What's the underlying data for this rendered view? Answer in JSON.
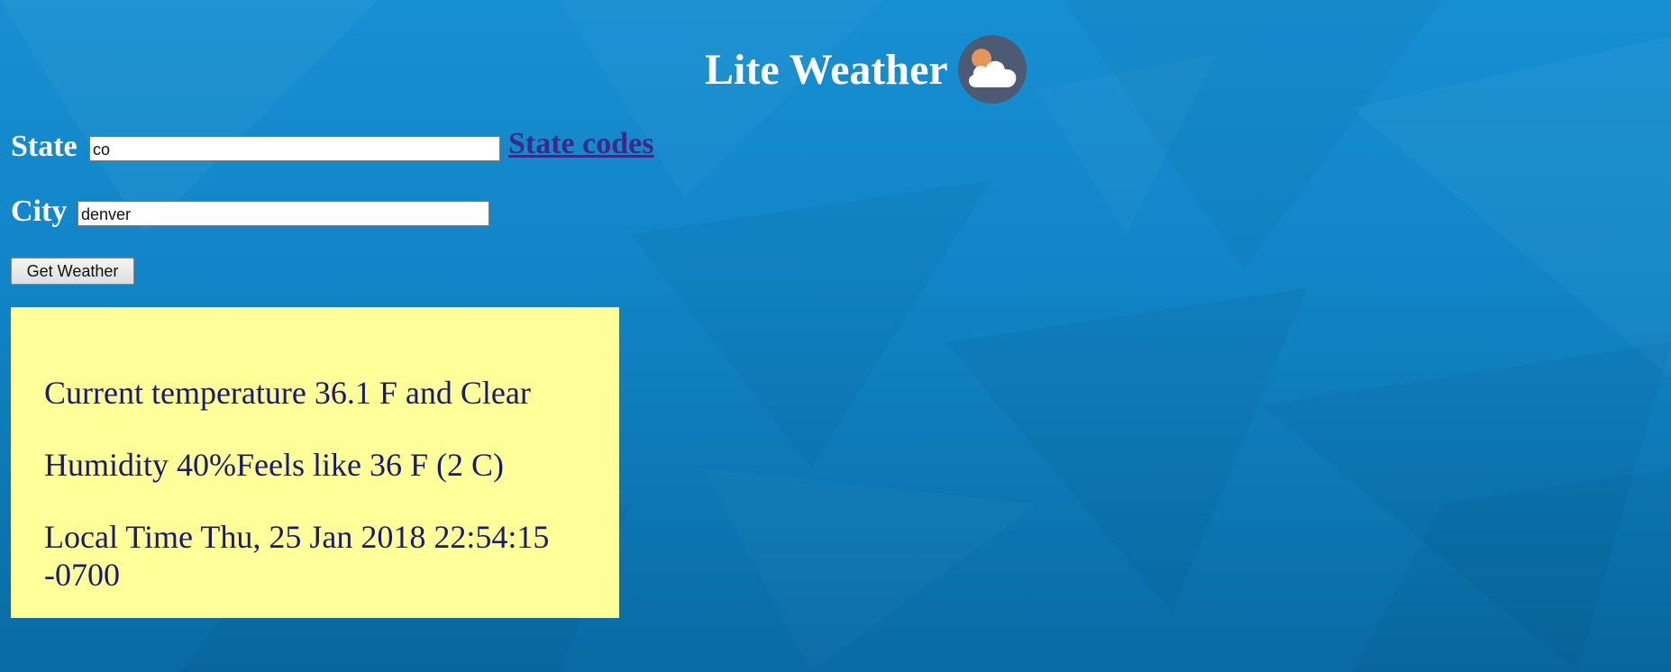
{
  "app": {
    "title": "Lite Weather",
    "logo_icon": "sun-cloud-icon"
  },
  "form": {
    "state_label": "State",
    "state_value": "co",
    "state_codes_link": "State codes",
    "city_label": "City",
    "city_value": "denver",
    "submit_label": "Get Weather"
  },
  "result": {
    "temperature_line": "Current temperature 36.1 F and Clear",
    "humidity_line": "Humidity 40%Feels like 36 F (2 C)",
    "local_time_line": "Local Time Thu, 25 Jan 2018 22:54:15 -0700"
  },
  "colors": {
    "background": "#1185c7",
    "result_background": "#ffff99",
    "result_text": "#1a1a6e",
    "link": "#3b2a8c",
    "logo_circle": "#4d5a73",
    "logo_sun": "#e8935a"
  }
}
